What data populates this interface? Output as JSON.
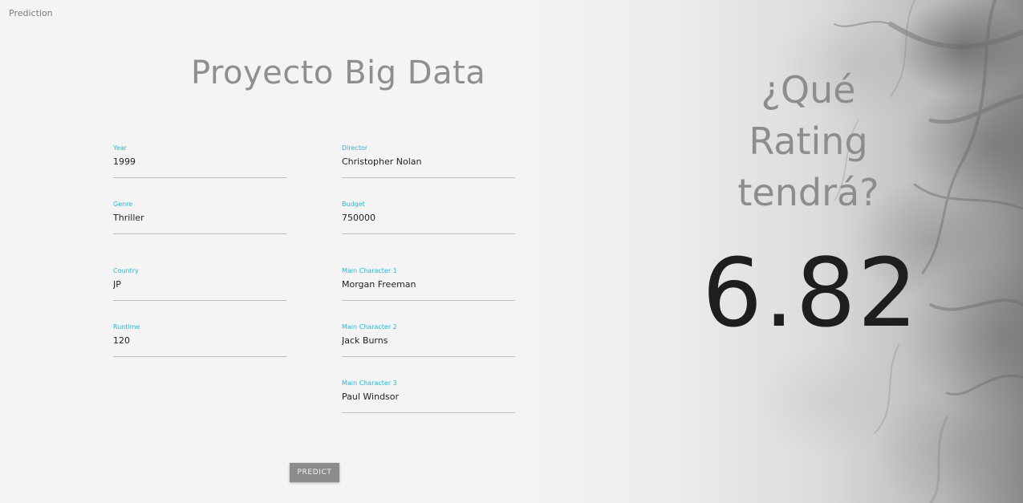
{
  "app": {
    "title": "Prediction"
  },
  "page": {
    "title": "Proyecto Big Data"
  },
  "form": {
    "year": {
      "label": "Year",
      "value": "1999"
    },
    "director": {
      "label": "Director",
      "value": "Christopher Nolan"
    },
    "genre": {
      "label": "Genre",
      "value": "Thriller"
    },
    "budget": {
      "label": "Budget",
      "value": "750000"
    },
    "country": {
      "label": "Country",
      "value": "JP"
    },
    "main_character_1": {
      "label": "Main Character 1",
      "value": "Morgan Freeman"
    },
    "runtime": {
      "label": "Runtime",
      "value": "120"
    },
    "main_character_2": {
      "label": "Main Character 2",
      "value": "Jack Burns"
    },
    "main_character_3": {
      "label": "Main Character 3",
      "value": "Paul Windsor"
    },
    "predict_label": "PREDICT"
  },
  "hero": {
    "question_line1": "¿Qué",
    "question_line2": "Rating",
    "question_line3": "tendrá?",
    "result": "6.82"
  },
  "colors": {
    "accent_label": "#2bb8d6",
    "button_bg": "#8c8c8c",
    "title": "#8f8f8f",
    "result": "#1e1e1e"
  }
}
